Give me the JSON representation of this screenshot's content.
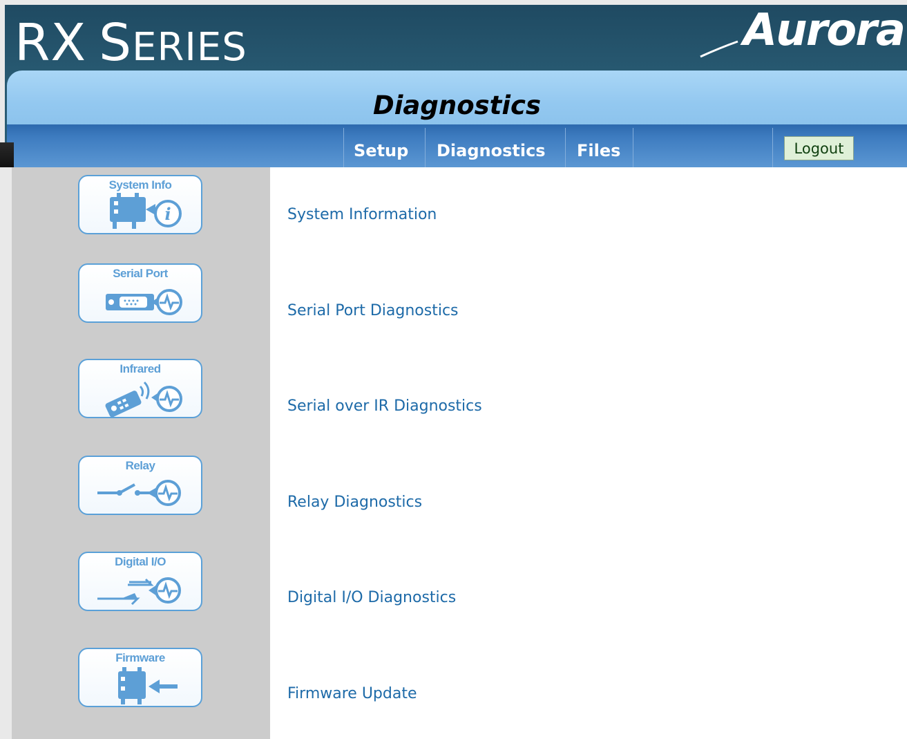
{
  "header": {
    "brand_big": "RX",
    "brand_rest": " SERIES",
    "brand_rest_first": "S",
    "brand_rest_tail": "ERIES",
    "logo": "Aurora"
  },
  "page": {
    "title": "Diagnostics"
  },
  "nav": {
    "links": [
      "Setup",
      "Diagnostics",
      "Files"
    ],
    "logout_label": "Logout"
  },
  "tiles": [
    {
      "label": "System Info",
      "icon": "system-info-icon"
    },
    {
      "label": "Serial Port",
      "icon": "serial-port-icon"
    },
    {
      "label": "Infrared",
      "icon": "infrared-icon"
    },
    {
      "label": "Relay",
      "icon": "relay-icon"
    },
    {
      "label": "Digital I/O",
      "icon": "digital-io-icon"
    },
    {
      "label": "Firmware",
      "icon": "firmware-icon"
    }
  ],
  "links": [
    "System Information",
    "Serial Port Diagnostics",
    "Serial over IR Diagnostics",
    "Relay Diagnostics",
    "Digital I/O Diagnostics",
    "Firmware Update"
  ],
  "colors": {
    "banner": "#285a72",
    "title_bar": "#93c8f0",
    "nav_bar": "#3e7cc0",
    "tile_icon": "#5d9fd6",
    "link": "#1d6aa8"
  }
}
